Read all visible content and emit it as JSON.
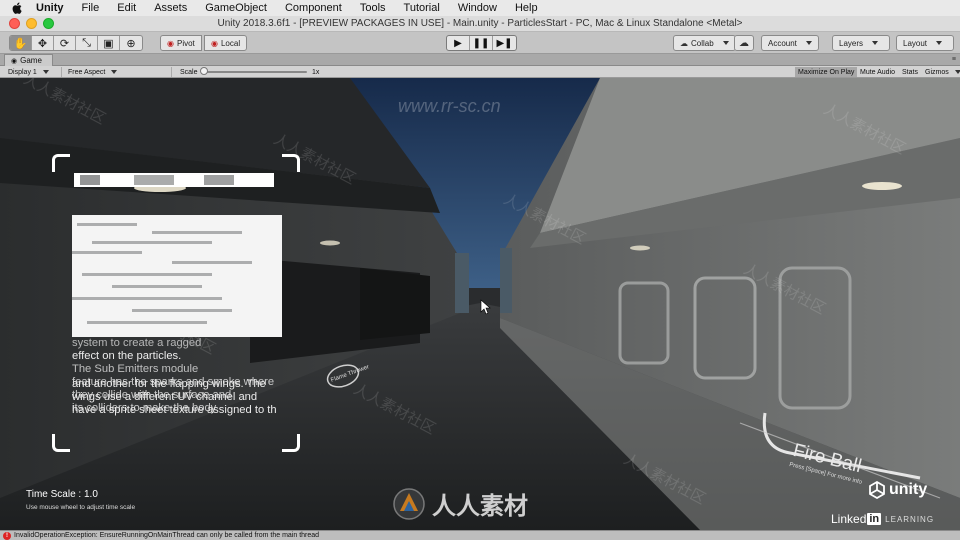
{
  "menubar": {
    "app": "Unity",
    "items": [
      "File",
      "Edit",
      "Assets",
      "GameObject",
      "Component",
      "Tools",
      "Tutorial",
      "Window",
      "Help"
    ]
  },
  "window": {
    "title": "Unity 2018.3.6f1 - [PREVIEW PACKAGES IN USE] - Main.unity - ParticlesStart - PC, Mac & Linux Standalone <Metal>"
  },
  "toolbar": {
    "pivot_label": "Pivot",
    "local_label": "Local",
    "collab_label": "Collab",
    "account_label": "Account",
    "layers_label": "Layers",
    "layout_label": "Layout",
    "tools": [
      "hand-tool-icon",
      "move-tool-icon",
      "rotate-tool-icon",
      "scale-tool-icon",
      "rect-tool-icon",
      "transform-tool-icon"
    ]
  },
  "game_tab": {
    "label": "Game"
  },
  "game_bar": {
    "display": "Display 1",
    "aspect": "Free Aspect",
    "scale_label": "Scale",
    "scale_value": "1x",
    "maximize_on_play": "Maximize On Play",
    "mute_audio": "Mute Audio",
    "stats": "Stats",
    "gizmos": "Gizmos"
  },
  "scene": {
    "panel_visible_lines": [
      "system to create a ragged",
      "effect on the particles.",
      "The Sub Emitters module",
      "feature has the sparks and smoke where",
      "they collide with the surface and",
      "its colliders to make the body",
      "and another for the flapping wings. The",
      "wings use a different UV channel and",
      "have a sprite sheet texture assigned to th"
    ],
    "time_scale": "Time Scale : 1.0",
    "time_hint": "Use mouse wheel to adjust time scale",
    "fire_ball": "Fire Ball",
    "fire_ball_sub": "Press [Space] For more info",
    "flame_label": "Flame Thrower"
  },
  "branding": {
    "unity": "unity",
    "linkedin_prefix": "Linked",
    "linkedin_in": "in",
    "learning": "LEARNING",
    "watermark_cn": "人人素材",
    "watermark_bg": "人人素材社区",
    "watermark_url": "www.rr-sc.cn"
  },
  "statusbar": {
    "message": "InvalidOperationException: EnsureRunningOnMainThread can only be called from the main thread"
  }
}
